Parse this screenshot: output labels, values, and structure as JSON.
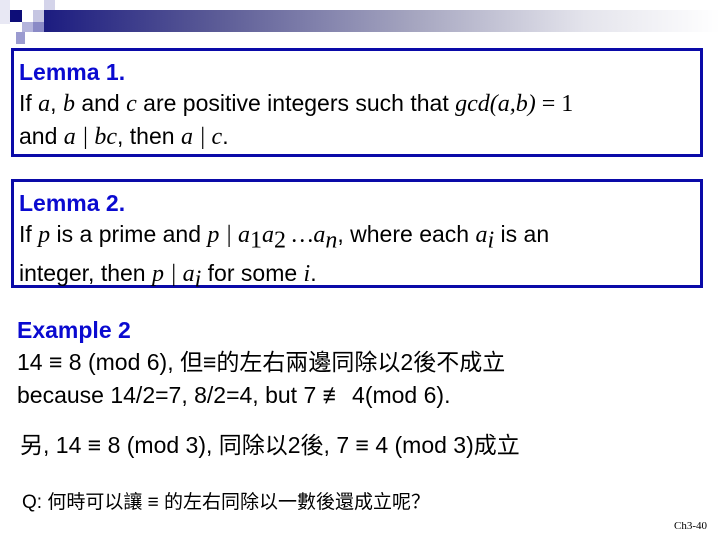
{
  "lemma1": {
    "title": "Lemma 1.",
    "l1_a": "If ",
    "l1_v1": "a",
    "l1_b": ", ",
    "l1_v2": "b",
    "l1_c": " and ",
    "l1_v3": "c",
    "l1_d": " are positive integers such that ",
    "l1_gcd": "gcd",
    "l1_args": "(a,b)",
    "l1_eq": " = 1",
    "l2_a": "and ",
    "l2_m1": "a | bc",
    "l2_b": ", then ",
    "l2_m2": "a | c",
    "l2_c": "."
  },
  "lemma2": {
    "title": "Lemma 2.",
    "l1_a": "If ",
    "l1_p": "p",
    "l1_b": " is a prime and ",
    "l1_div": "p | a",
    "l1_s1": "1",
    "l1_a2": "a",
    "l1_s2": "2",
    "l1_dots": " …a",
    "l1_sn": "n",
    "l1_c": ", where each ",
    "l1_ai": "a",
    "l1_si": "i",
    "l1_d": " is an",
    "l2_a": "integer, then ",
    "l2_div": "p | a",
    "l2_si": "i",
    "l2_b": " for some ",
    "l2_i": "i",
    "l2_c": "."
  },
  "example": {
    "title": "Example 2",
    "line1": "14 ≡ 8 (mod 6), 但≡的左右兩邊同除以2後不成立",
    "line2_a": "because 14/2=7, 8/2=4,   but 7 ",
    "line2_neq": "≢",
    "line2_b": " 4(mod 6)."
  },
  "another": "另, 14 ≡ 8 (mod 3), 同除以2後, 7 ≡ 4 (mod 3)成立",
  "question": "Q: 何時可以讓 ≡ 的左右同除以一數後還成立呢？",
  "page_number": "Ch3-40"
}
